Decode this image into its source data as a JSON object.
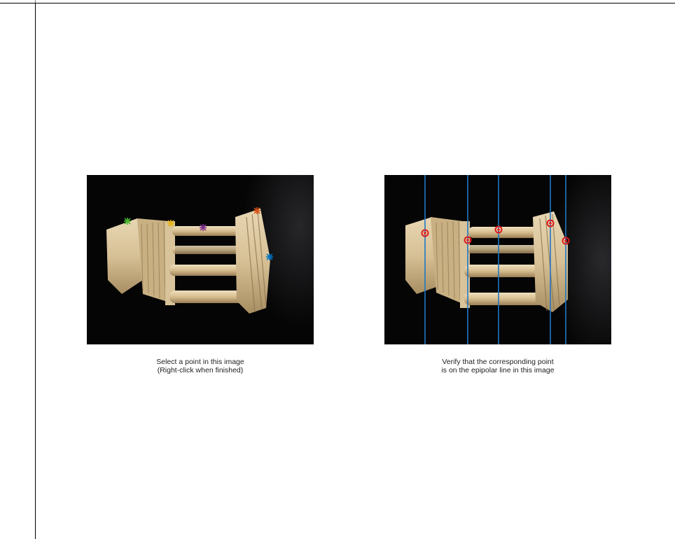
{
  "figure": {
    "left_panel": {
      "caption_line1": "Select a point in this image",
      "caption_line2": "(Right-click when finished)",
      "markers": [
        {
          "name": "green-star-marker",
          "color": "#4db834"
        },
        {
          "name": "yellow-star-marker",
          "color": "#e6b418"
        },
        {
          "name": "purple-star-marker",
          "color": "#7e2f8e"
        },
        {
          "name": "orange-star-marker",
          "color": "#d95319"
        },
        {
          "name": "blue-star-marker",
          "color": "#0072bd"
        }
      ]
    },
    "right_panel": {
      "caption_line1": "Verify that the corresponding point",
      "caption_line2": "is on the epipolar line in this image",
      "epipolar_line_color": "#1f77c4",
      "point_marker_color": "#e0191a"
    }
  }
}
